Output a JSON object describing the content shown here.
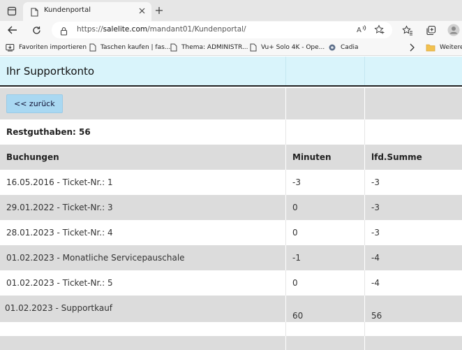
{
  "browser": {
    "tab_title": "Kundenportal",
    "url_prefix": "https://",
    "url_host": "salelite.com",
    "url_path": "/mandant01/Kundenportal/",
    "favorites": [
      "Favoriten importieren",
      "Taschen kaufen | fas...",
      "Thema: ADMINISTR...",
      "Vu+ Solo 4K - Ope...",
      "Cadia",
      "Weitere"
    ]
  },
  "page": {
    "title": "Ihr Supportkonto",
    "back_label": "<< zurück",
    "balance_label": "Restguthaben: 56",
    "headers": [
      "Buchungen",
      "Minuten",
      "lfd.Summe"
    ],
    "rows": [
      [
        "16.05.2016 - Ticket-Nr.: 1",
        "-3",
        "-3"
      ],
      [
        "29.01.2022 - Ticket-Nr.: 3",
        "0",
        "-3"
      ],
      [
        "28.01.2023 - Ticket-Nr.: 4",
        "0",
        "-3"
      ],
      [
        "01.02.2023 - Monatliche Servicepauschale",
        "-1",
        "-4"
      ],
      [
        "01.02.2023 - Ticket-Nr.: 5",
        "0",
        "-4"
      ],
      [
        "01.02.2023 - Supportkauf",
        "60",
        "56"
      ]
    ]
  }
}
